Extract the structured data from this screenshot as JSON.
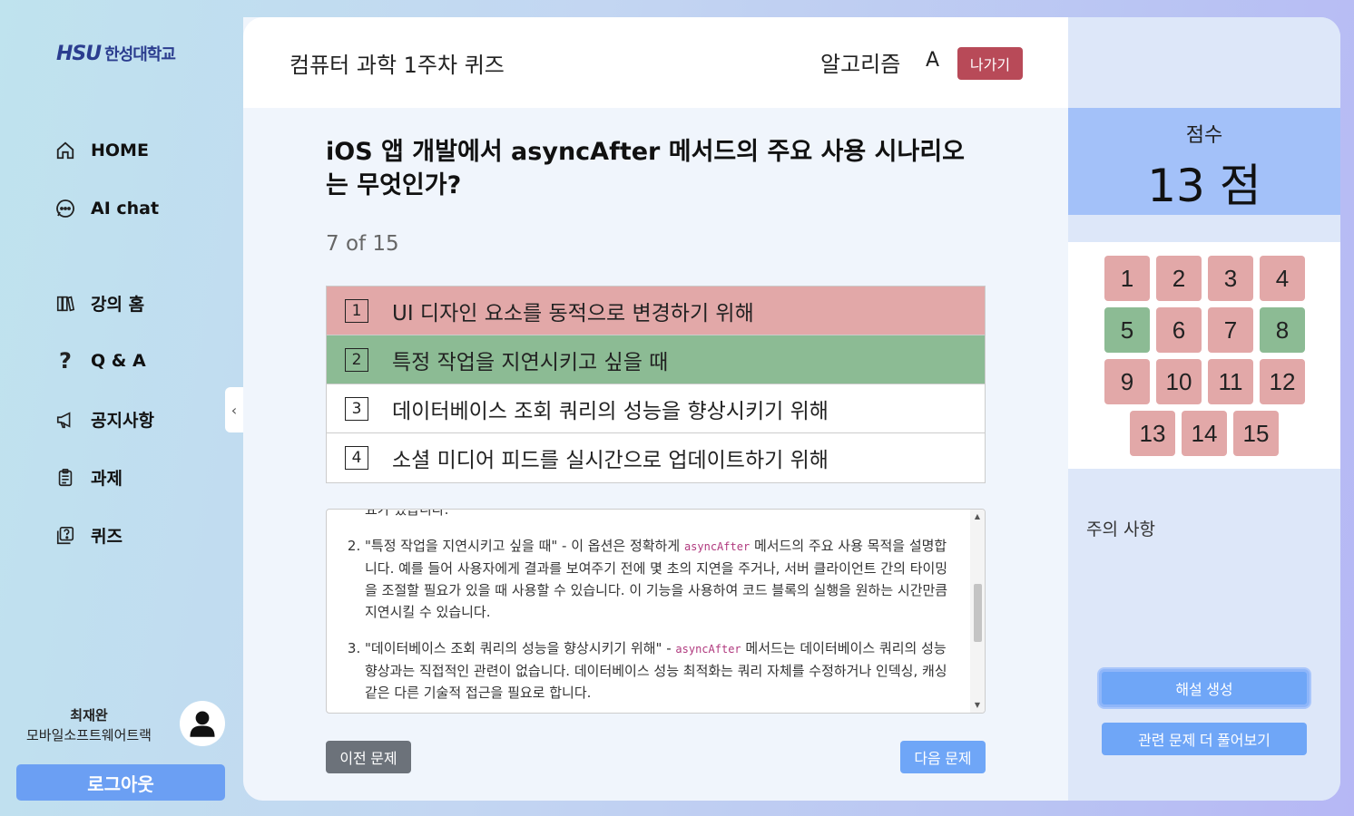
{
  "brand": {
    "mark": "HSU",
    "name": "한성대학교"
  },
  "nav": [
    {
      "label": "HOME",
      "icon": "home-icon"
    },
    {
      "label": "AI chat",
      "icon": "chat-icon"
    },
    {
      "label": "강의 홈",
      "icon": "book-icon"
    },
    {
      "label": "Q & A",
      "icon": "question-icon"
    },
    {
      "label": "공지사항",
      "icon": "megaphone-icon"
    },
    {
      "label": "과제",
      "icon": "clipboard-icon"
    },
    {
      "label": "퀴즈",
      "icon": "quiz-icon"
    }
  ],
  "user": {
    "name": "최재완",
    "track": "모바일소프트웨어트랙"
  },
  "logout_label": "로그아웃",
  "header": {
    "quiz_title": "컴퓨터 과학 1주차 퀴즈",
    "topic": "알고리즘",
    "grade": "A",
    "exit_label": "나가기"
  },
  "question": {
    "text": "iOS 앱 개발에서 asyncAfter 메서드의 주요 사용 시나리오는 무엇인가?",
    "progress": "7 of 15"
  },
  "options": [
    {
      "num": "1",
      "text": "UI 디자인 요소를 동적으로 변경하기 위해",
      "state": "wrong"
    },
    {
      "num": "2",
      "text": "특정 작업을 지연시키고 싶을 때",
      "state": "correct"
    },
    {
      "num": "3",
      "text": "데이터베이스 조회 쿼리의 성능을 향상시키기 위해",
      "state": "neutral"
    },
    {
      "num": "4",
      "text": "소셜 미디어 피드를 실시간으로 업데이트하기 위해",
      "state": "neutral"
    }
  ],
  "explanation": {
    "fragment": "요가 있습니다.",
    "item2_a": "\"특정 작업을 지연시키고 싶을 때\" - 이 옵션은 정확하게 ",
    "item2_code": "asyncAfter",
    "item2_b": " 메서드의 주요 사용 목적을 설명합니다. 예를 들어 사용자에게 결과를 보여주기 전에 몇 초의 지연을 주거나, 서버 클라이언트 간의 타이밍을 조절할 필요가 있을 때 사용할 수 있습니다. 이 기능을 사용하여 코드 블록의 실행을 원하는 시간만큼 지연시킬 수 있습니다.",
    "item3_a": "\"데이터베이스 조회 쿼리의 성능을 향상시키기 위해\" - ",
    "item3_code": "asyncAfter",
    "item3_b": " 메서드는 데이터베이스 쿼리의 성능 향상과는 직접적인 관련이 없습니다. 데이터베이스 성능 최적화는 쿼리 자체를 수정하거나 인덱싱, 캐싱 같은 다른 기술적 접근을 필요로 합니다."
  },
  "footer_nav": {
    "prev_label": "이전 문제",
    "next_label": "다음 문제"
  },
  "score": {
    "label": "점수",
    "value": "13 점"
  },
  "question_grid": [
    {
      "n": "1",
      "state": "wrong"
    },
    {
      "n": "2",
      "state": "wrong"
    },
    {
      "n": "3",
      "state": "wrong"
    },
    {
      "n": "4",
      "state": "wrong"
    },
    {
      "n": "5",
      "state": "correct"
    },
    {
      "n": "6",
      "state": "wrong"
    },
    {
      "n": "7",
      "state": "wrong"
    },
    {
      "n": "8",
      "state": "correct"
    },
    {
      "n": "9",
      "state": "wrong"
    },
    {
      "n": "10",
      "state": "wrong"
    },
    {
      "n": "11",
      "state": "wrong"
    },
    {
      "n": "12",
      "state": "wrong"
    },
    {
      "n": "13",
      "state": "wrong"
    },
    {
      "n": "14",
      "state": "wrong"
    },
    {
      "n": "15",
      "state": "wrong"
    }
  ],
  "notice_label": "주의 사항",
  "generate_label": "해설 생성",
  "more_label": "관련 문제 더 풀어보기",
  "colors": {
    "wrong": "#e2a8a8",
    "correct": "#8cbb94",
    "accent": "#6fa6f7",
    "exit": "#b84a58"
  }
}
